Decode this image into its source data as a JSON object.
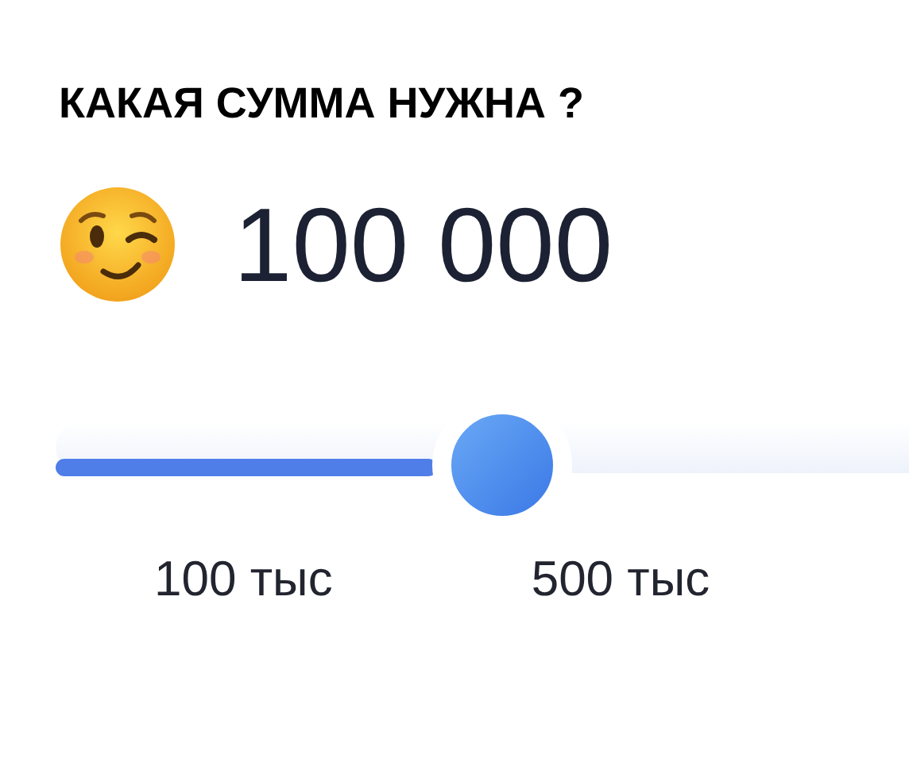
{
  "title": "КАКАЯ СУММА НУЖНА ?",
  "amount": "100 000",
  "scale_labels": [
    "100 тыс",
    "500 тыс"
  ]
}
